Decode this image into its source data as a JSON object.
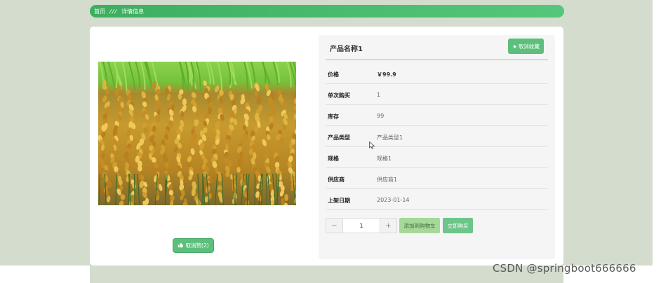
{
  "breadcrumb": {
    "home": "首页",
    "separator": "///",
    "current": "详情信息"
  },
  "product": {
    "title": "产品名称1",
    "favorite_label": "取消收藏",
    "like_label": "取消赞(2)",
    "details": [
      {
        "label": "价格",
        "value": "￥99.9"
      },
      {
        "label": "单次购买",
        "value": "1"
      },
      {
        "label": "库存",
        "value": "99"
      },
      {
        "label": "产品类型",
        "value": "产品类型1"
      },
      {
        "label": "规格",
        "value": "规格1"
      },
      {
        "label": "供应商",
        "value": "供应商1"
      },
      {
        "label": "上架日期",
        "value": "2023-01-14"
      }
    ]
  },
  "purchase": {
    "minus": "−",
    "plus": "+",
    "quantity": "1",
    "add_to_cart_label": "添加到购物车",
    "buy_now_label": "立即购买"
  },
  "icons": {
    "favorite": "star-icon",
    "like": "thumbs-up-icon"
  },
  "colors": {
    "accent": "#5cbf7c",
    "breadcrumb_start": "#3dae5f",
    "breadcrumb_end": "#56c77a",
    "cart_button": "#a6d89a"
  },
  "watermark": "CSDN @springboot666666"
}
